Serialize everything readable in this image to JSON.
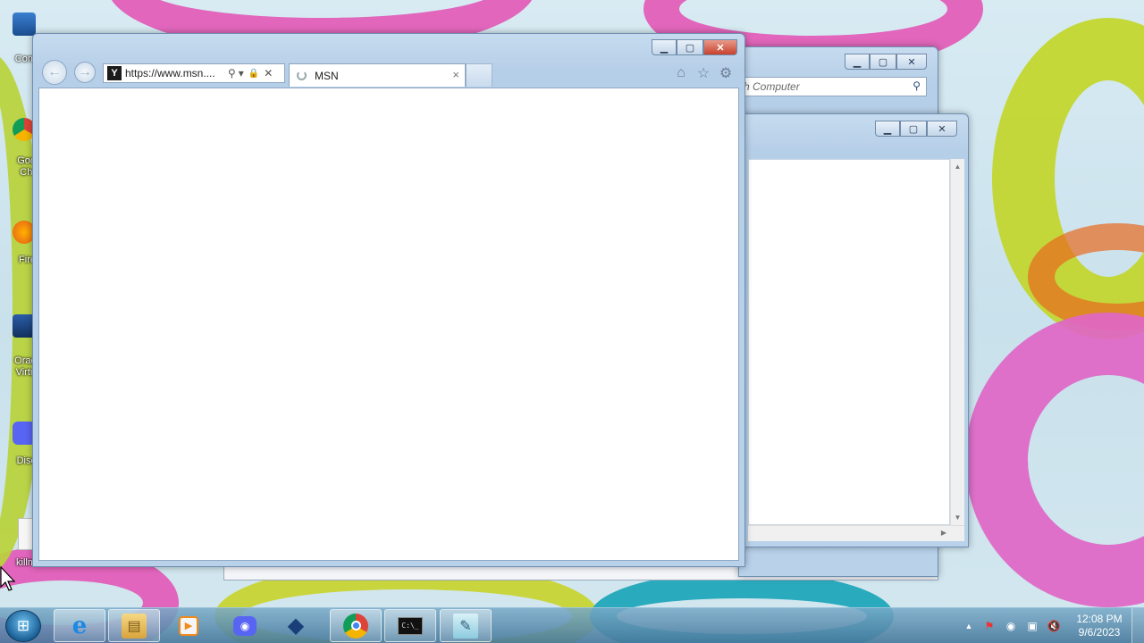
{
  "desktop": {
    "icons": [
      {
        "label": "Com",
        "icon": "computer-icon"
      },
      {
        "label": "Goo\nChr",
        "icon": "chrome-icon"
      },
      {
        "label": "Fire",
        "icon": "firefox-icon"
      },
      {
        "label": "Orac\nVirtu",
        "icon": "virtualbox-icon"
      },
      {
        "label": "Disc",
        "icon": "discord-icon"
      },
      {
        "label": "killm",
        "icon": "file-icon"
      }
    ]
  },
  "ie": {
    "url": "https://www.msn....",
    "tab_title": "MSN",
    "tab_close": "×",
    "back": "←",
    "forward": "→",
    "search_glyph": "⚲",
    "dropdown_glyph": "▾",
    "lock_glyph": "🔒",
    "stop_glyph": "✕",
    "home_glyph": "⌂",
    "favorites_glyph": "☆",
    "tools_glyph": "⚙",
    "min": "▁",
    "max": "▢",
    "close": "✕"
  },
  "explorer_back": {
    "search_placeholder": "h Computer",
    "search_glyph": "⚲",
    "min": "▁",
    "max": "▢",
    "close": "✕"
  },
  "explorer_front": {
    "min": "▁",
    "max": "▢",
    "close": "✕",
    "scroll_up": "▲",
    "scroll_down": "▼",
    "scroll_right": "▶"
  },
  "taskbar": {
    "start_glyph": "⊞",
    "apps": [
      {
        "name": "internet-explorer",
        "glyph": "e",
        "active": true
      },
      {
        "name": "file-explorer",
        "glyph": "▤",
        "active": true
      },
      {
        "name": "media-player",
        "glyph": "▶",
        "active": false
      },
      {
        "name": "discord",
        "glyph": "◉",
        "active": false
      },
      {
        "name": "virtualbox",
        "glyph": "◆",
        "active": false
      },
      {
        "name": "chrome",
        "glyph": "◎",
        "active": true
      },
      {
        "name": "command-prompt",
        "glyph": "C:\\_",
        "active": true
      },
      {
        "name": "notepad",
        "glyph": "✎",
        "active": true
      }
    ],
    "tray": {
      "overflow": "▲",
      "flag": "⚑",
      "discord": "◉",
      "network": "▣",
      "volume": "🔇"
    },
    "time": "12:08 PM",
    "date": "9/6/2023"
  },
  "colors": {
    "ie_close": "#c8412c",
    "window_frame": "#b9d2ea",
    "taskbar": "#4678a0"
  }
}
